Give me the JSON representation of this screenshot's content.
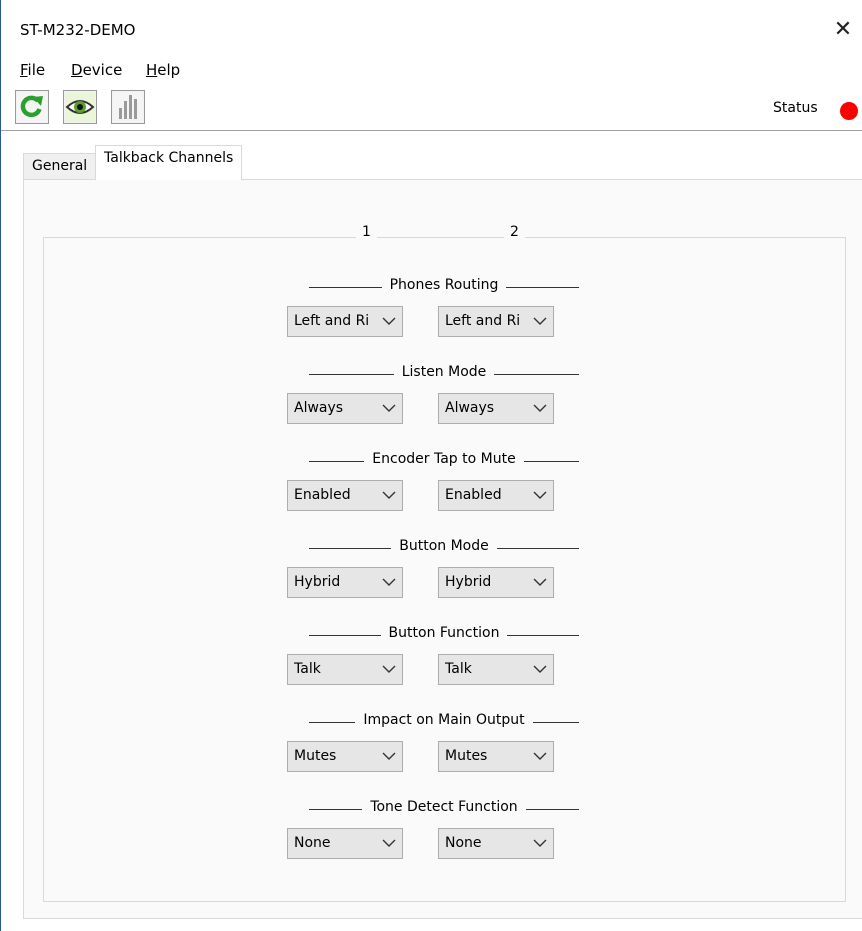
{
  "window": {
    "title": "ST-M232-DEMO",
    "close_glyph": "✕"
  },
  "menu": [
    {
      "label": "File",
      "accel": "F",
      "rest": "ile"
    },
    {
      "label": "Device",
      "accel": "D",
      "rest": "evice"
    },
    {
      "label": "Help",
      "accel": "H",
      "rest": "elp"
    }
  ],
  "toolbar": {
    "buttons": [
      "refresh-icon",
      "eye-icon",
      "meter-icon"
    ],
    "status_label": "Status",
    "status_color": "#ff0000"
  },
  "tabs": [
    {
      "label": "General",
      "active": false
    },
    {
      "label": "Talkback Channels",
      "active": true
    }
  ],
  "channels": [
    "1",
    "2"
  ],
  "sections": [
    {
      "title": "Phones Routing",
      "values": [
        "Left and Ri",
        "Left and Ri"
      ]
    },
    {
      "title": "Listen Mode",
      "values": [
        "Always",
        "Always"
      ]
    },
    {
      "title": "Encoder Tap to Mute",
      "values": [
        "Enabled",
        "Enabled"
      ]
    },
    {
      "title": "Button Mode",
      "values": [
        "Hybrid",
        "Hybrid"
      ]
    },
    {
      "title": "Button Function",
      "values": [
        "Talk",
        "Talk"
      ]
    },
    {
      "title": "Impact on Main Output",
      "values": [
        "Mutes",
        "Mutes"
      ]
    },
    {
      "title": "Tone Detect Function",
      "values": [
        "None",
        "None"
      ]
    }
  ]
}
